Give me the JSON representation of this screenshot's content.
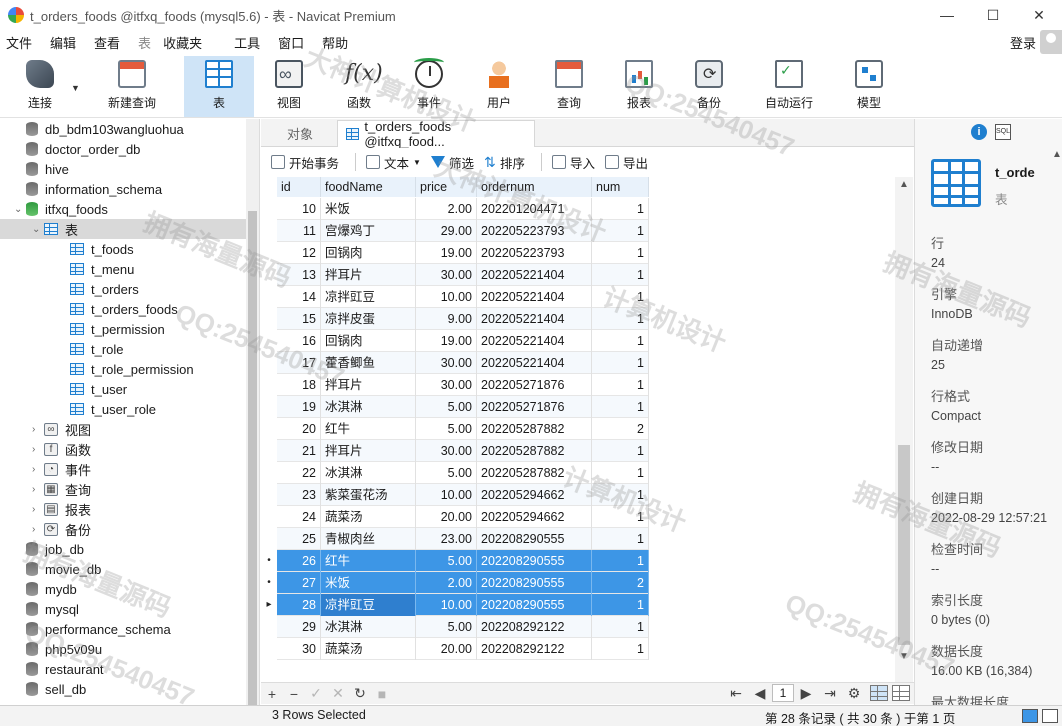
{
  "window": {
    "title": "t_orders_foods @itfxq_foods (mysql5.6) - 表 - Navicat Premium",
    "minimize": "—",
    "maximize": "☐",
    "close": "✕"
  },
  "menu": {
    "items": [
      "文件",
      "编辑",
      "查看",
      "表",
      "收藏夹",
      "工具",
      "窗口",
      "帮助"
    ],
    "login": "登录"
  },
  "toolbar": {
    "buttons": [
      {
        "label": "连接",
        "icon": "plug-icon"
      },
      {
        "label": "新建查询",
        "icon": "new-query-icon"
      },
      {
        "label": "表",
        "icon": "table-icon"
      },
      {
        "label": "视图",
        "icon": "view-icon"
      },
      {
        "label": "函数",
        "icon": "function-icon"
      },
      {
        "label": "事件",
        "icon": "event-clock-icon"
      },
      {
        "label": "用户",
        "icon": "user-icon"
      },
      {
        "label": "查询",
        "icon": "query-icon"
      },
      {
        "label": "报表",
        "icon": "report-icon"
      },
      {
        "label": "备份",
        "icon": "backup-icon"
      },
      {
        "label": "自动运行",
        "icon": "auto-run-icon"
      },
      {
        "label": "模型",
        "icon": "model-icon"
      }
    ]
  },
  "sidebar": {
    "items": [
      {
        "label": "db_bdm103wangluohua",
        "kind": "db"
      },
      {
        "label": "doctor_order_db",
        "kind": "db"
      },
      {
        "label": "hive",
        "kind": "db"
      },
      {
        "label": "information_schema",
        "kind": "db"
      },
      {
        "label": "itfxq_foods",
        "kind": "db-open",
        "expander": "⌄"
      },
      {
        "label": "表",
        "kind": "group-open",
        "expander": "⌄"
      },
      {
        "label": "t_foods",
        "kind": "table"
      },
      {
        "label": "t_menu",
        "kind": "table"
      },
      {
        "label": "t_orders",
        "kind": "table"
      },
      {
        "label": "t_orders_foods",
        "kind": "table"
      },
      {
        "label": "t_permission",
        "kind": "table"
      },
      {
        "label": "t_role",
        "kind": "table"
      },
      {
        "label": "t_role_permission",
        "kind": "table"
      },
      {
        "label": "t_user",
        "kind": "table"
      },
      {
        "label": "t_user_role",
        "kind": "table"
      },
      {
        "label": "视图",
        "kind": "group",
        "expander": "›",
        "glyph": "∞"
      },
      {
        "label": "函数",
        "kind": "group",
        "expander": "›",
        "glyph": "f"
      },
      {
        "label": "事件",
        "kind": "group",
        "expander": "›",
        "glyph": "◔"
      },
      {
        "label": "查询",
        "kind": "group",
        "expander": "›",
        "glyph": "▦"
      },
      {
        "label": "报表",
        "kind": "group",
        "expander": "›",
        "glyph": "▤"
      },
      {
        "label": "备份",
        "kind": "group",
        "expander": "›",
        "glyph": "⟳"
      },
      {
        "label": "job_db",
        "kind": "db"
      },
      {
        "label": "movie_db",
        "kind": "db"
      },
      {
        "label": "mydb",
        "kind": "db"
      },
      {
        "label": "mysql",
        "kind": "db"
      },
      {
        "label": "performance_schema",
        "kind": "db"
      },
      {
        "label": "php5v09u",
        "kind": "db"
      },
      {
        "label": "restaurant",
        "kind": "db"
      },
      {
        "label": "sell_db",
        "kind": "db"
      }
    ]
  },
  "tabs": {
    "objects": "对象",
    "active": "t_orders_foods @itfxq_food..."
  },
  "table_toolbar": {
    "begin_tx": "开始事务",
    "text": "文本",
    "filter": "筛选",
    "sort": "排序",
    "import": "导入",
    "export": "导出"
  },
  "grid": {
    "columns": [
      "id",
      "foodName",
      "price",
      "ordernum",
      "num"
    ],
    "rows": [
      [
        "10",
        "米饭",
        "2.00",
        "202201204471",
        "1"
      ],
      [
        "11",
        "宫爆鸡丁",
        "29.00",
        "202205223793",
        "1"
      ],
      [
        "12",
        "回锅肉",
        "19.00",
        "202205223793",
        "1"
      ],
      [
        "13",
        "拌耳片",
        "30.00",
        "202205221404",
        "1"
      ],
      [
        "14",
        "凉拌豇豆",
        "10.00",
        "202205221404",
        "1"
      ],
      [
        "15",
        "凉拌皮蛋",
        "9.00",
        "202205221404",
        "1"
      ],
      [
        "16",
        "回锅肉",
        "19.00",
        "202205221404",
        "1"
      ],
      [
        "17",
        "藿香鲫鱼",
        "30.00",
        "202205221404",
        "1"
      ],
      [
        "18",
        "拌耳片",
        "30.00",
        "202205271876",
        "1"
      ],
      [
        "19",
        "冰淇淋",
        "5.00",
        "202205271876",
        "1"
      ],
      [
        "20",
        "红牛",
        "5.00",
        "202205287882",
        "2"
      ],
      [
        "21",
        "拌耳片",
        "30.00",
        "202205287882",
        "1"
      ],
      [
        "22",
        "冰淇淋",
        "5.00",
        "202205287882",
        "1"
      ],
      [
        "23",
        "紫菜蛋花汤",
        "10.00",
        "202205294662",
        "1"
      ],
      [
        "24",
        "蔬菜汤",
        "20.00",
        "202205294662",
        "1"
      ],
      [
        "25",
        "青椒肉丝",
        "23.00",
        "202208290555",
        "1"
      ],
      [
        "26",
        "红牛",
        "5.00",
        "202208290555",
        "1"
      ],
      [
        "27",
        "米饭",
        "2.00",
        "202208290555",
        "2"
      ],
      [
        "28",
        "凉拌豇豆",
        "10.00",
        "202208290555",
        "1"
      ],
      [
        "29",
        "冰淇淋",
        "5.00",
        "202208292122",
        "1"
      ],
      [
        "30",
        "蔬菜汤",
        "20.00",
        "202208292122",
        "1"
      ]
    ],
    "selected_rows": [
      16,
      17,
      18
    ],
    "focused_row": 18,
    "markers": {
      "16": "•",
      "17": "•",
      "18": "▸"
    }
  },
  "bottom_bar": {
    "add": "+",
    "delete": "−",
    "apply": "✓",
    "discard": "✕",
    "refresh": "↻",
    "stop": "■",
    "first": "⇤",
    "prev": "◀",
    "page": "1",
    "next": "▶",
    "last": "⇥",
    "settings": "⚙"
  },
  "info_panel": {
    "name": "t_orde",
    "kind": "表",
    "props": [
      {
        "key": "行",
        "value": "24"
      },
      {
        "key": "引擎",
        "value": "InnoDB"
      },
      {
        "key": "自动递增",
        "value": "25"
      },
      {
        "key": "行格式",
        "value": "Compact"
      },
      {
        "key": "修改日期",
        "value": "--"
      },
      {
        "key": "创建日期",
        "value": "2022-08-29 12:57:21"
      },
      {
        "key": "检查时间",
        "value": "--"
      },
      {
        "key": "索引长度",
        "value": "0 bytes (0)"
      },
      {
        "key": "数据长度",
        "value": "16.00 KB (16,384)"
      },
      {
        "key": "最大数据长度",
        "value": ""
      }
    ]
  },
  "status": {
    "selection": "3 Rows Selected",
    "record": "第 28 条记录 ( 共 30 条 ) 于第 1 页"
  },
  "watermark": {
    "texts": [
      "拥有海量源码",
      "QQ:254540457",
      "大神计算机设计",
      "计算机设计",
      "QQ:254540457",
      "拥有海量源码",
      "QQ:254540457",
      "大神计算机设计",
      "拥有海量源码",
      "QQ:254540457",
      "计算机设计",
      "拥有海量源码"
    ]
  },
  "colors": {
    "accent": "#1f7fcf",
    "selection": "#3d96e6",
    "header": "#e9f2fb"
  }
}
